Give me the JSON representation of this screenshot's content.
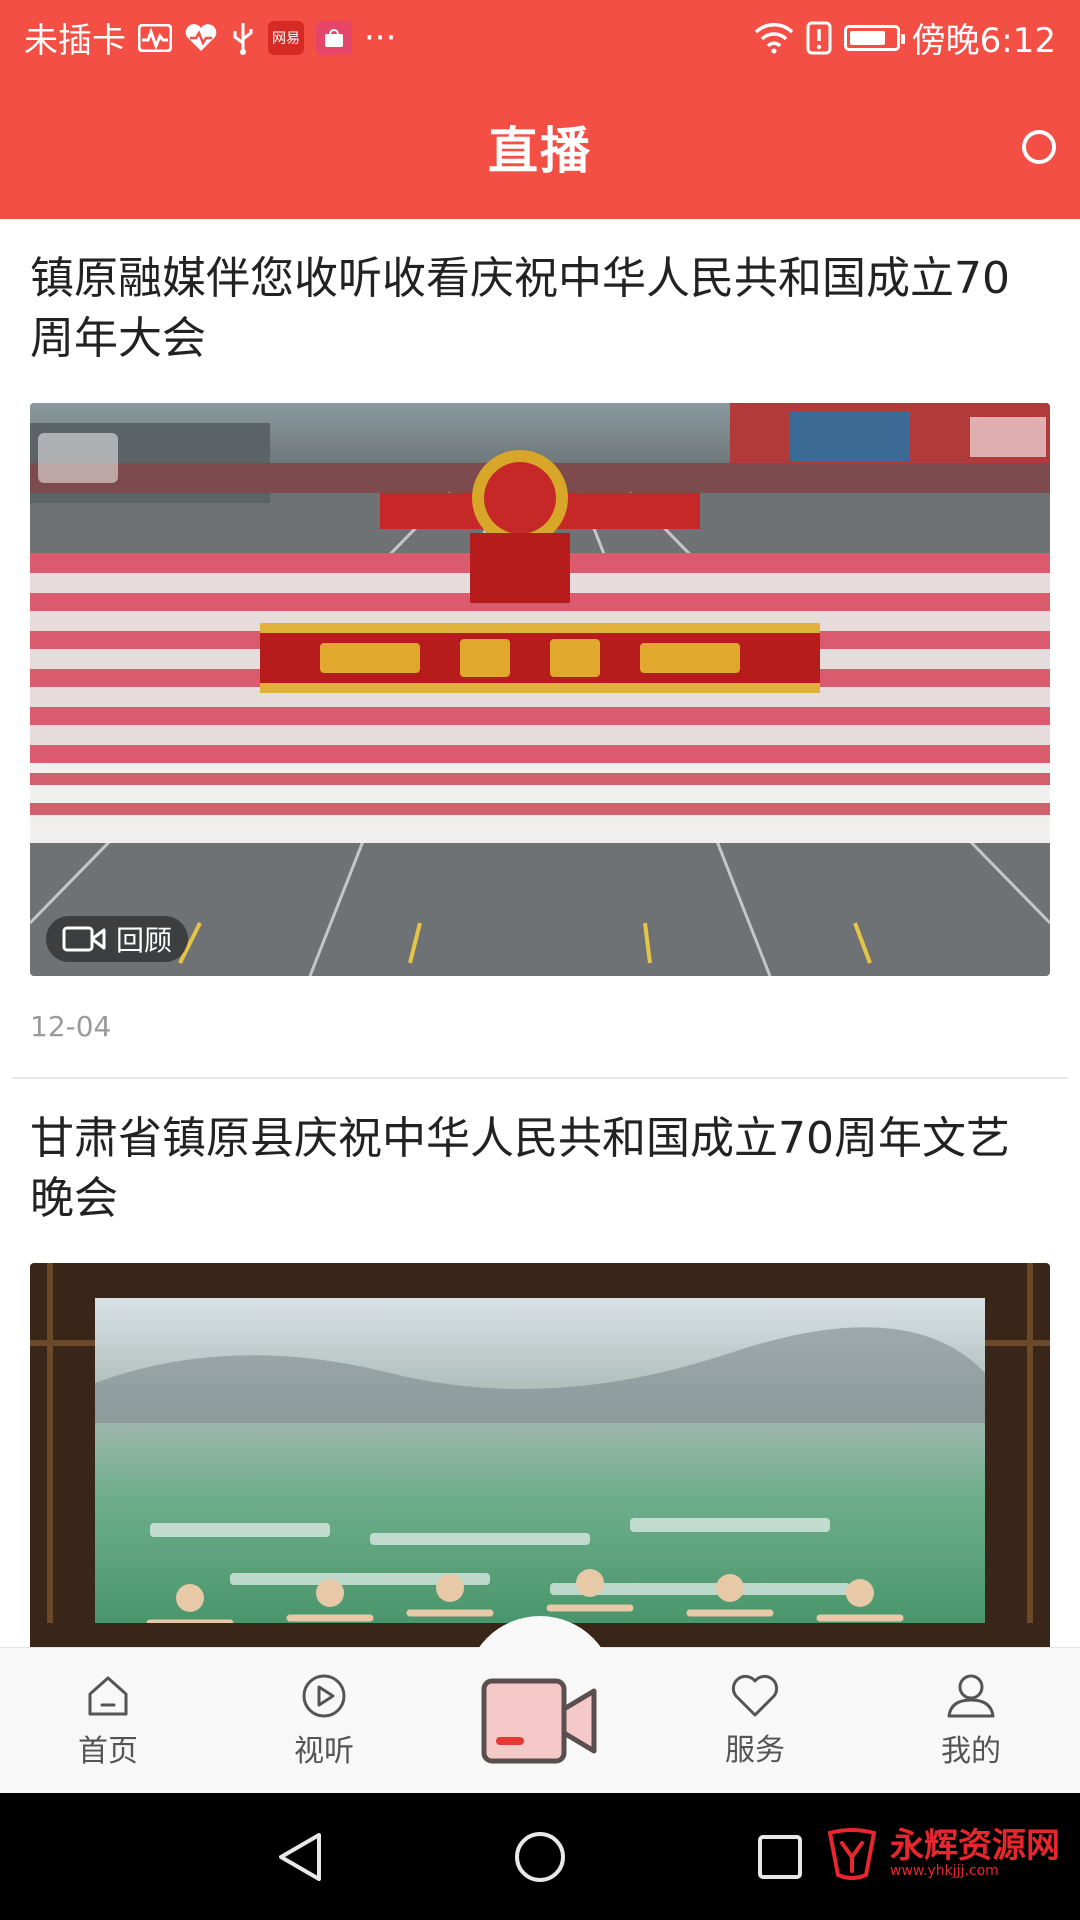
{
  "status_bar": {
    "carrier": "未插卡",
    "time": "傍晚6:12",
    "icons": [
      "activity-icon",
      "heart-icon",
      "usb-icon",
      "netease-app-icon",
      "shopping-app-icon",
      "more-icon",
      "wifi-icon",
      "alert-icon",
      "battery-icon"
    ],
    "badge_netease": "网易",
    "more": "···"
  },
  "header": {
    "title": "直播"
  },
  "feed": [
    {
      "title": "镇原融媒伴您收听收看庆祝中华人民共和国成立70周年大会",
      "badge": "回顾",
      "date": "12-04"
    },
    {
      "title": "甘肃省镇原县庆祝中华人民共和国成立70周年文艺晚会"
    }
  ],
  "bottom_nav": {
    "items": [
      {
        "label": "首页",
        "icon": "home-icon"
      },
      {
        "label": "视听",
        "icon": "play-icon"
      },
      {
        "label": "",
        "icon": "video-camera-icon"
      },
      {
        "label": "服务",
        "icon": "heart-icon"
      },
      {
        "label": "我的",
        "icon": "user-icon"
      }
    ]
  },
  "watermark": {
    "text": "永辉资源网",
    "url": "www.yhkjjj.com"
  },
  "colors": {
    "accent": "#f44f45",
    "nav_bg": "#f8f8f8",
    "system_nav_bg": "#000000"
  }
}
